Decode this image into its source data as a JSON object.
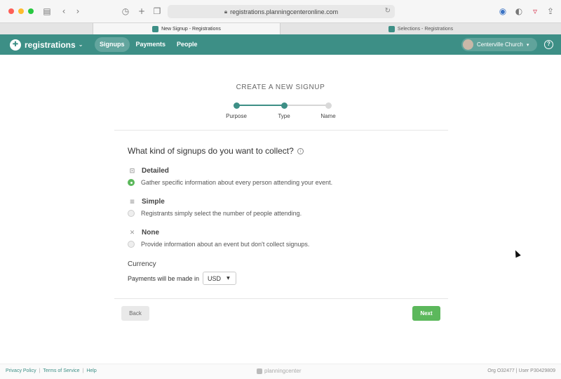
{
  "browser": {
    "url": "registrations.planningcenteronline.com",
    "tabs": [
      {
        "title": "New Signup - Registrations",
        "active": true
      },
      {
        "title": "Selections - Registrations",
        "active": false
      }
    ]
  },
  "app": {
    "name": "registrations",
    "nav": [
      "Signups",
      "Payments",
      "People"
    ],
    "active_nav": "Signups",
    "org": "Centerville Church",
    "help": "?"
  },
  "wizard": {
    "title": "CREATE A NEW SIGNUP",
    "steps": [
      {
        "label": "Purpose",
        "state": "done"
      },
      {
        "label": "Type",
        "state": "current"
      },
      {
        "label": "Name",
        "state": "todo"
      }
    ],
    "question": "What kind of signups do you want to collect?",
    "options": [
      {
        "title": "Detailed",
        "description": "Gather specific information about every person attending your event.",
        "selected": true,
        "icon": "person-form-icon"
      },
      {
        "title": "Simple",
        "description": "Registrants simply select the number of people attending.",
        "selected": false,
        "icon": "list-icon"
      },
      {
        "title": "None",
        "description": "Provide information about an event but don't collect signups.",
        "selected": false,
        "icon": "x-icon"
      }
    ],
    "currency": {
      "heading": "Currency",
      "label": "Payments will be made in",
      "selected": "USD"
    },
    "back_label": "Back",
    "next_label": "Next"
  },
  "footer": {
    "links": [
      "Privacy Policy",
      "Terms of Service",
      "Help"
    ],
    "brand": "planningcenter",
    "ids": "Org O32477 | User P30429809"
  },
  "colors": {
    "brand": "#3d8f86",
    "success": "#5cb85c"
  }
}
